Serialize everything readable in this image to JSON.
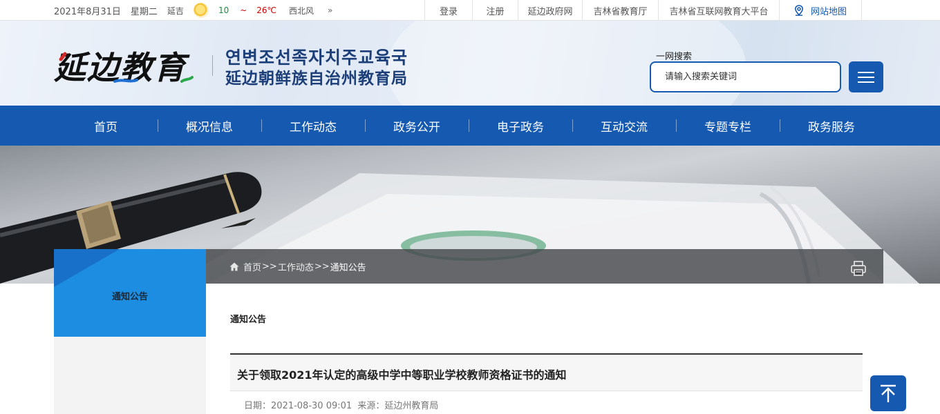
{
  "topbar": {
    "date": "2021年8月31日",
    "weekday": "星期二",
    "weather": {
      "city": "延吉",
      "low": "10",
      "tilde": "~",
      "high": "26℃",
      "wind": "西北风",
      "more": "»",
      "icon": "sun-icon"
    },
    "links": [
      {
        "label": "登录"
      },
      {
        "label": "注册"
      },
      {
        "label": "延边政府网"
      },
      {
        "label": "吉林省教育厅"
      },
      {
        "label": "吉林省互联网教育大平台"
      },
      {
        "label": "网站地图",
        "icon": "map-pin-icon"
      }
    ]
  },
  "header": {
    "logo_calligraphy": "延边教育",
    "logo_korean": "연변조선족자치주교육국",
    "logo_chinese": "延边朝鲜族自治州教育局",
    "search_label": "一网搜索",
    "search_placeholder": "请输入搜索关键词",
    "menu_icon": "hamburger-icon"
  },
  "nav": [
    "首页",
    "概况信息",
    "工作动态",
    "政务公开",
    "电子政务",
    "互动交流",
    "专题专栏",
    "政务服务"
  ],
  "breadcrumb": {
    "home": "首页",
    "sep": ">>",
    "level1": "工作动态",
    "current": "通知公告",
    "print_icon": "printer-icon"
  },
  "sidebar": {
    "title": "通知公告"
  },
  "content": {
    "section_title": "通知公告",
    "article_title": "关于领取2021年认定的高级中学中等职业学校教师资格证书的通知",
    "date_label": "日期：",
    "date": "2021-08-30 09:01",
    "source_label": "来源：",
    "source": "延边州教育局"
  },
  "colors": {
    "primary": "#1659b0",
    "sidebar_blue": "#1c8de0",
    "text_dark": "#333333"
  }
}
